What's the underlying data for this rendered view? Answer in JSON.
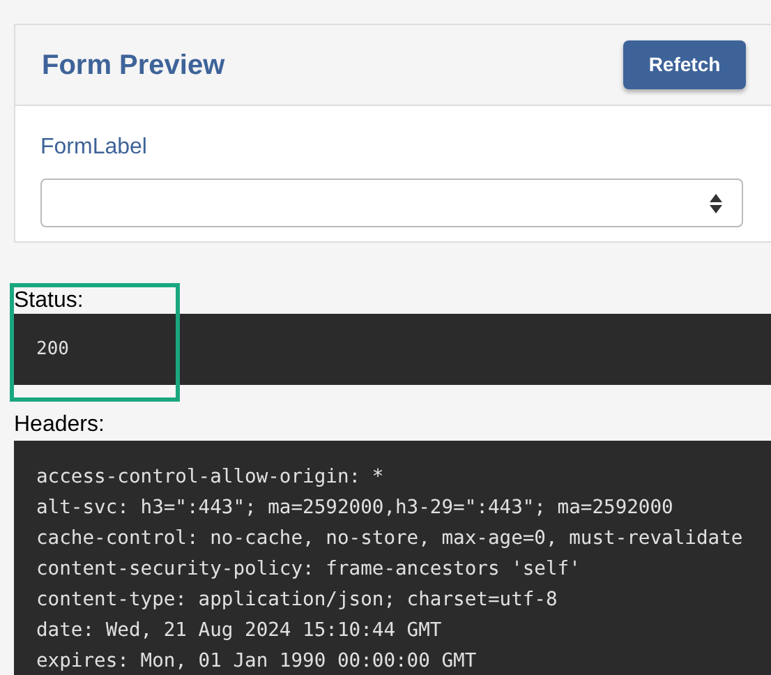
{
  "card": {
    "title": "Form Preview",
    "button": "Refetch",
    "field_label": "FormLabel"
  },
  "status": {
    "label": "Status:",
    "value": "200"
  },
  "headers": {
    "label": "Headers:",
    "lines": [
      "access-control-allow-origin: *",
      "alt-svc: h3=\":443\"; ma=2592000,h3-29=\":443\"; ma=2592000",
      "cache-control: no-cache, no-store, max-age=0, must-revalidate",
      "content-security-policy: frame-ancestors 'self'",
      "content-type: application/json; charset=utf-8",
      "date: Wed, 21 Aug 2024 15:10:44 GMT",
      "expires: Mon, 01 Jan 1990 00:00:00 GMT"
    ]
  }
}
